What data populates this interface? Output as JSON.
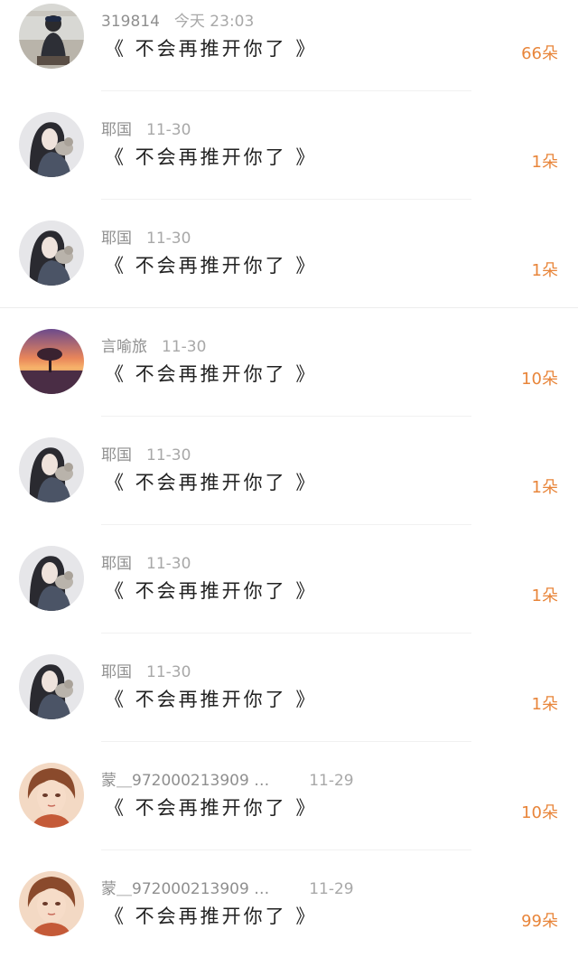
{
  "colors": {
    "count_accent": "#e8853a",
    "meta_text": "#9a9a9a",
    "title_text": "#222222"
  },
  "comments": [
    {
      "user": "319814",
      "time": "今天 23:03",
      "title": "《 不会再推开你了 》",
      "count": "66朵",
      "avatar": "photo-avatar"
    },
    {
      "user": "耶国",
      "time": "11-30",
      "title": "《 不会再推开你了 》",
      "count": "1朵",
      "avatar": "girl-with-cat-avatar"
    },
    {
      "user": "耶国",
      "time": "11-30",
      "title": "《 不会再推开你了 》",
      "count": "1朵",
      "avatar": "girl-with-cat-avatar"
    },
    {
      "user": "言喻旅",
      "time": "11-30",
      "title": "《 不会再推开你了 》",
      "count": "10朵",
      "avatar": "sunset-tree-avatar"
    },
    {
      "user": "耶国",
      "time": "11-30",
      "title": "《 不会再推开你了 》",
      "count": "1朵",
      "avatar": "girl-with-cat-avatar"
    },
    {
      "user": "耶国",
      "time": "11-30",
      "title": "《 不会再推开你了 》",
      "count": "1朵",
      "avatar": "girl-with-cat-avatar"
    },
    {
      "user": "耶国",
      "time": "11-30",
      "title": "《 不会再推开你了 》",
      "count": "1朵",
      "avatar": "girl-with-cat-avatar"
    },
    {
      "user": "蒙＿972000213909 …",
      "time": "11-29",
      "title": "《 不会再推开你了 》",
      "count": "10朵",
      "avatar": "anime-boy-avatar"
    },
    {
      "user": "蒙＿972000213909 …",
      "time": "11-29",
      "title": "《 不会再推开你了 》",
      "count": "99朵",
      "avatar": "anime-boy-avatar"
    }
  ]
}
